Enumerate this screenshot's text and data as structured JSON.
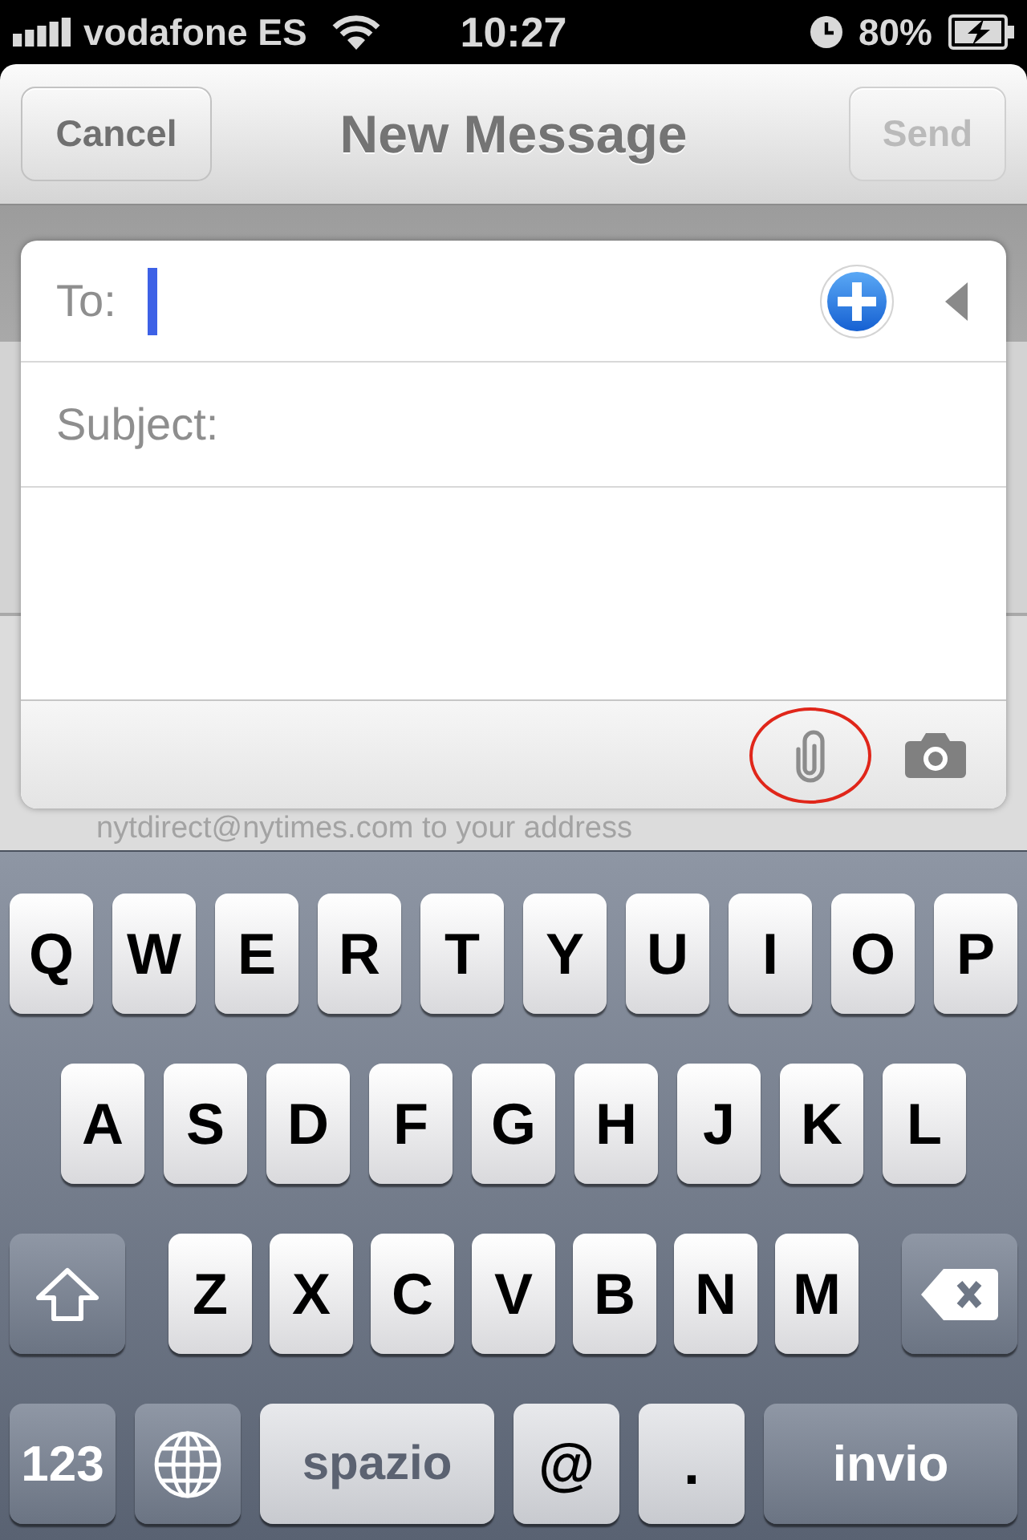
{
  "status_bar": {
    "carrier": "vodafone ES",
    "time": "10:27",
    "battery": "80%"
  },
  "nav_bar": {
    "cancel_button": {
      "label": "Cancel",
      "disabled": false
    },
    "title": "New Message",
    "send_button": {
      "label": "Send",
      "disabled": true
    }
  },
  "compose": {
    "to_field": {
      "label": "To:",
      "focused": true
    },
    "subject_field": {
      "label": "Subject:",
      "focused": false
    },
    "toolbar": [
      {
        "kind": "attach",
        "highlighted": true
      },
      {
        "kind": "camera",
        "highlighted": false
      }
    ]
  },
  "background_text": "nytdirect@nytimes.com to your address",
  "keyboard": {
    "rows": [
      {
        "keys": [
          {
            "kind": "letter",
            "label": "Q"
          },
          {
            "kind": "letter",
            "label": "W"
          },
          {
            "kind": "letter",
            "label": "E"
          },
          {
            "kind": "letter",
            "label": "R"
          },
          {
            "kind": "letter",
            "label": "T"
          },
          {
            "kind": "letter",
            "label": "Y"
          },
          {
            "kind": "letter",
            "label": "U"
          },
          {
            "kind": "letter",
            "label": "I"
          },
          {
            "kind": "letter",
            "label": "O"
          },
          {
            "kind": "letter",
            "label": "P"
          }
        ]
      },
      {
        "keys": [
          {
            "kind": "letter",
            "label": "A"
          },
          {
            "kind": "letter",
            "label": "S"
          },
          {
            "kind": "letter",
            "label": "D"
          },
          {
            "kind": "letter",
            "label": "F"
          },
          {
            "kind": "letter",
            "label": "G"
          },
          {
            "kind": "letter",
            "label": "H"
          },
          {
            "kind": "letter",
            "label": "J"
          },
          {
            "kind": "letter",
            "label": "K"
          },
          {
            "kind": "letter",
            "label": "L"
          }
        ]
      },
      {
        "keys": [
          {
            "kind": "shift"
          },
          {
            "kind": "letter",
            "label": "Z"
          },
          {
            "kind": "letter",
            "label": "X"
          },
          {
            "kind": "letter",
            "label": "C"
          },
          {
            "kind": "letter",
            "label": "V"
          },
          {
            "kind": "letter",
            "label": "B"
          },
          {
            "kind": "letter",
            "label": "N"
          },
          {
            "kind": "letter",
            "label": "M"
          },
          {
            "kind": "delete"
          }
        ]
      },
      {
        "keys": [
          {
            "kind": "mode",
            "label": "123"
          },
          {
            "kind": "globe"
          },
          {
            "kind": "space",
            "label": "spazio"
          },
          {
            "kind": "symbol",
            "label": "@"
          },
          {
            "kind": "symbol",
            "label": "."
          },
          {
            "kind": "return",
            "label": "invio"
          }
        ]
      }
    ]
  }
}
